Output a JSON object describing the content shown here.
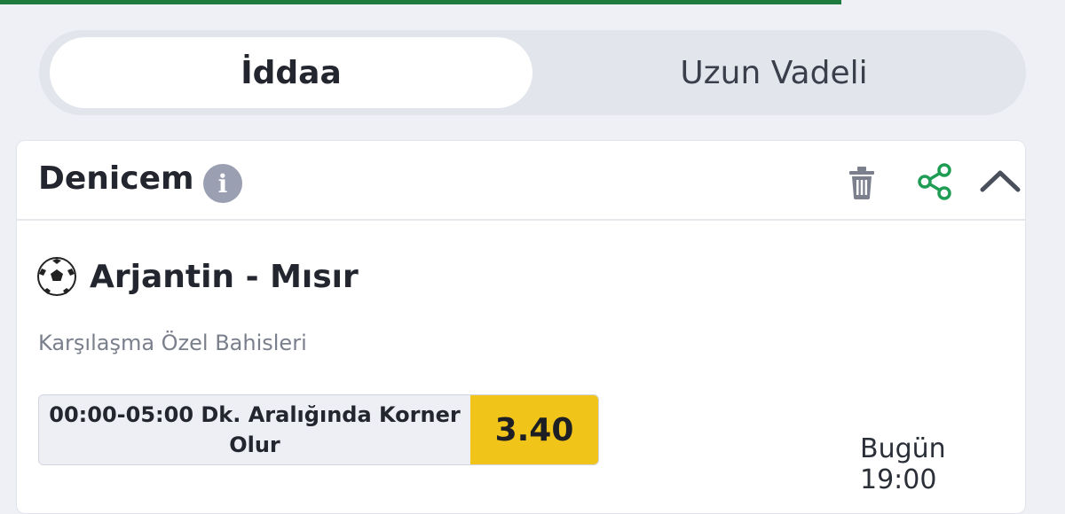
{
  "progress": {
    "fraction": 0.79
  },
  "tabs": [
    {
      "label": "İddaa",
      "active": true
    },
    {
      "label": "Uzun Vadeli",
      "active": false
    }
  ],
  "coupon": {
    "title": "Denicem",
    "icons": [
      "info-icon",
      "trash-icon",
      "share-icon",
      "chevron-up-icon"
    ]
  },
  "selection": {
    "sport_icon": "soccer-ball-icon",
    "match": "Arjantin - Mısır",
    "category": "Karşılaşma Özel Bahisleri",
    "bet": "00:00-05:00 Dk. Aralığında Korner Olur",
    "odds": "3.40",
    "time": "Bugün 19:00"
  },
  "colors": {
    "accent_green": "#1f9d55",
    "odds_yellow": "#f0c419",
    "progress_green": "#1f7a3e"
  }
}
